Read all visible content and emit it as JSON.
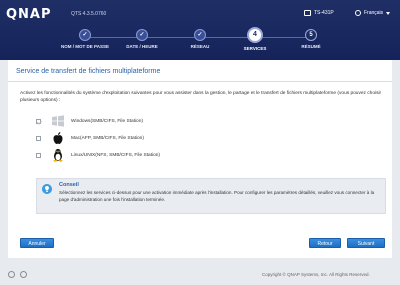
{
  "header": {
    "logo": "QNAP",
    "version": "QTS 4.3.5.0760",
    "device": "TS-431P",
    "language": "Français"
  },
  "steps": [
    {
      "number": "✓",
      "label": "NOM / MOT DE PASSE",
      "state": "done"
    },
    {
      "number": "✓",
      "label": "DATE / HEURE",
      "state": "done"
    },
    {
      "number": "✓",
      "label": "RÉSEAU",
      "state": "done"
    },
    {
      "number": "4",
      "label": "SERVICES",
      "state": "active"
    },
    {
      "number": "5",
      "label": "RÉSUMÉ",
      "state": "pending"
    }
  ],
  "main": {
    "title": "Service de transfert de fichiers multiplateforme",
    "intro": "Activez les fonctionnalités du système d'exploitation suivantes pour vous assister dans la gestion, le partage et le transfert de fichiers multiplateforme (vous pouvez choisir plusieurs options) :",
    "options": [
      {
        "label": "Windows(SMB/CIFS, File Station)",
        "icon": "windows-icon",
        "checked": true,
        "disabled": true
      },
      {
        "label": "Mac(AFP, SMB/CIFS, File Station)",
        "icon": "apple-icon",
        "checked": false,
        "disabled": false
      },
      {
        "label": "Linux/UNIX(NFS, SMB/CIFS, File Station)",
        "icon": "linux-icon",
        "checked": false,
        "disabled": false
      }
    ],
    "tip": {
      "title": "Conseil",
      "text": "Sélectionnez les services ci-dessus pour une activation immédiate après l'installation. Pour configurer les paramètres détaillés, veuillez vous connecter à la page d'administration une fois l'installation terminée."
    }
  },
  "buttons": {
    "cancel": "Annuler",
    "back": "Retour",
    "next": "Suivant"
  },
  "footer": {
    "copyright": "Copyright © QNAP Systems, Inc. All Rights Reserved."
  },
  "colors": {
    "header_bg": "#1a285f",
    "accent": "#2b63a6",
    "button": "#1d6fc4"
  }
}
